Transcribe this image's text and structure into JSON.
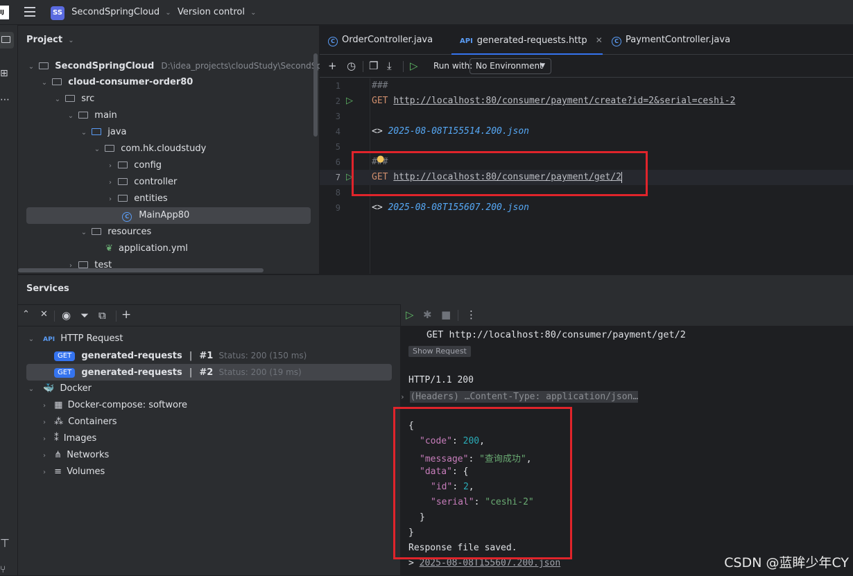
{
  "titlebar": {
    "app_logo": "IJ",
    "project_badge": "SS",
    "project_name": "SecondSpringCloud",
    "vcs_menu": "Version control"
  },
  "project_panel": {
    "title": "Project",
    "tree": [
      {
        "label": "SecondSpringCloud",
        "path": "D:\\idea_projects\\cloudStudy\\SecondSpri",
        "bold": true
      },
      {
        "label": "cloud-consumer-order80",
        "bold": true
      },
      {
        "label": "src"
      },
      {
        "label": "main"
      },
      {
        "label": "java"
      },
      {
        "label": "com.hk.cloudstudy"
      },
      {
        "label": "config"
      },
      {
        "label": "controller"
      },
      {
        "label": "entities"
      },
      {
        "label": "MainApp80"
      },
      {
        "label": "resources"
      },
      {
        "label": "application.yml"
      },
      {
        "label": "test"
      }
    ]
  },
  "editor": {
    "tabs": [
      {
        "label": "OrderController.java",
        "icon": "class-icon"
      },
      {
        "label": "generated-requests.http",
        "icon": "api-icon",
        "active": true
      },
      {
        "label": "PaymentController.java",
        "icon": "class-icon"
      }
    ],
    "toolbar": {
      "run_with_label": "Run with:",
      "environment": "No Environment"
    },
    "lines": [
      {
        "n": "1",
        "text": "###"
      },
      {
        "n": "2",
        "method": "GET",
        "url": "http://localhost:80/consumer/payment/create?id=2&serial=ceshi-2"
      },
      {
        "n": "3",
        "text": ""
      },
      {
        "n": "4",
        "prefix": "<>",
        "file": "2025-08-08T155514.200.json"
      },
      {
        "n": "5",
        "text": ""
      },
      {
        "n": "6",
        "text": "###"
      },
      {
        "n": "7",
        "method": "GET",
        "url": "http://localhost:80/consumer/payment/get/2"
      },
      {
        "n": "8",
        "text": ""
      },
      {
        "n": "9",
        "prefix": "<>",
        "file": "2025-08-08T155607.200.json"
      }
    ]
  },
  "services": {
    "title": "Services",
    "tree": {
      "http_request": "HTTP Request",
      "requests": [
        {
          "method": "GET",
          "name": "generated-requests",
          "num": "#1",
          "status": "Status: 200 (150 ms)"
        },
        {
          "method": "GET",
          "name": "generated-requests",
          "num": "#2",
          "status": "Status: 200 (19 ms)"
        }
      ],
      "docker": "Docker",
      "docker_children": [
        "Docker-compose: softwore",
        "Containers",
        "Images",
        "Networks",
        "Volumes"
      ]
    },
    "response": {
      "request_line": "GET http://localhost:80/consumer/payment/get/2",
      "show_request": "Show Request",
      "status_line": "HTTP/1.1 200",
      "headers": "(Headers) …Content-Type: application/json…",
      "json": {
        "open": "{",
        "code_key": "\"code\"",
        "code_val": "200",
        "message_key": "\"message\"",
        "message_val": "\"查询成功\"",
        "data_key": "\"data\"",
        "id_key": "\"id\"",
        "id_val": "2",
        "serial_key": "\"serial\"",
        "serial_val": "\"ceshi-2\"",
        "inner_close": "}",
        "close": "}"
      },
      "saved": "Response file saved.",
      "saved_file_prefix": ">",
      "saved_file": "2025-08-08T155607.200.json"
    }
  },
  "watermark": "CSDN @蓝眸少年CY"
}
